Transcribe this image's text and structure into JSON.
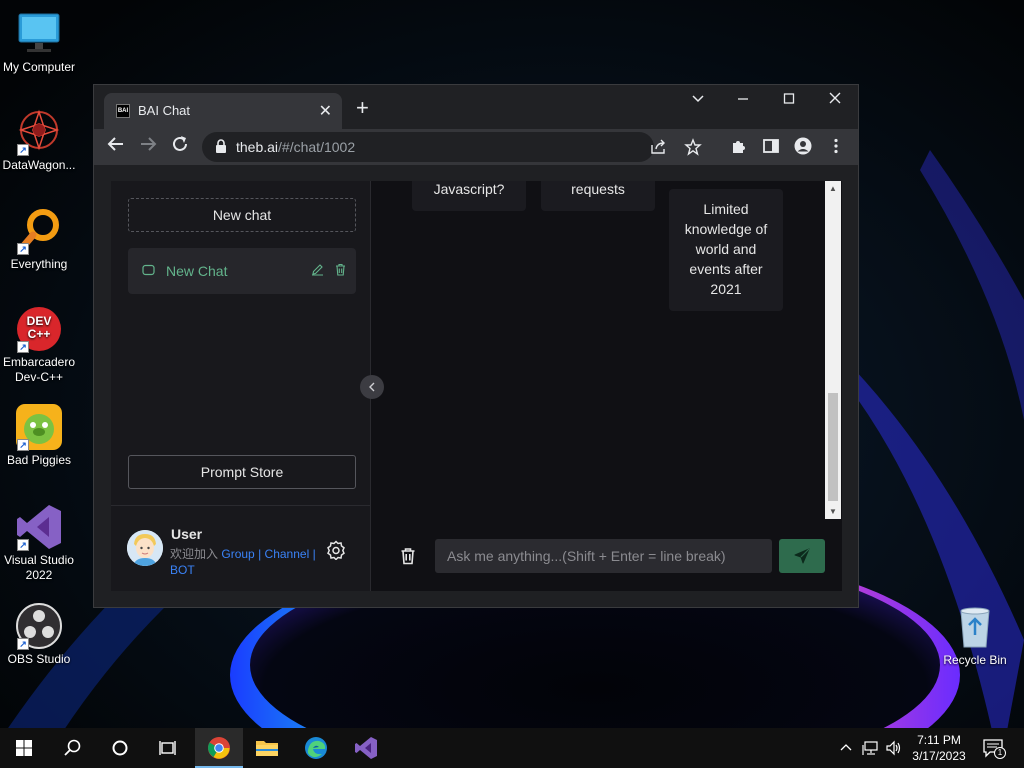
{
  "desktop": {
    "icons": [
      {
        "label": "My Computer",
        "icon": "computer-icon"
      },
      {
        "label": "DataWagon...",
        "icon": "datawagon-icon"
      },
      {
        "label": "Everything",
        "icon": "everything-search-icon"
      },
      {
        "label": "Embarcadero Dev-C++",
        "icon": "devcpp-icon",
        "badge": "DEV C++"
      },
      {
        "label": "Bad Piggies",
        "icon": "bad-piggies-icon"
      },
      {
        "label": "Visual Studio 2022",
        "icon": "visual-studio-icon"
      },
      {
        "label": "OBS Studio",
        "icon": "obs-studio-icon"
      },
      {
        "label": "Recycle Bin",
        "icon": "recycle-bin-icon"
      }
    ]
  },
  "browser": {
    "tab_title": "BAI Chat",
    "favicon_text": "BAI",
    "url_host": "theb.ai",
    "url_path": "/#/chat/1002"
  },
  "sidebar": {
    "new_chat_label": "New chat",
    "chat_items": [
      {
        "title": "New Chat"
      }
    ],
    "prompt_store_label": "Prompt Store",
    "user": {
      "name": "User",
      "desc_prefix": "欢迎加入",
      "link_group": "Group",
      "separator": "|",
      "link_channel": "Channel",
      "link_bot": "BOT"
    }
  },
  "chat": {
    "cards": [
      {
        "text": "Javascript?"
      },
      {
        "text": "requests"
      },
      {
        "text": "Limited knowledge of world and events after 2021"
      }
    ],
    "input_placeholder": "Ask me anything...(Shift + Enter = line break)"
  },
  "taskbar": {
    "time": "7:11 PM",
    "date": "3/17/2023",
    "notification_count": "1"
  },
  "colors": {
    "accent_green": "#63b48c",
    "send_button": "#2e6b4d",
    "link_blue": "#3a82f6"
  }
}
